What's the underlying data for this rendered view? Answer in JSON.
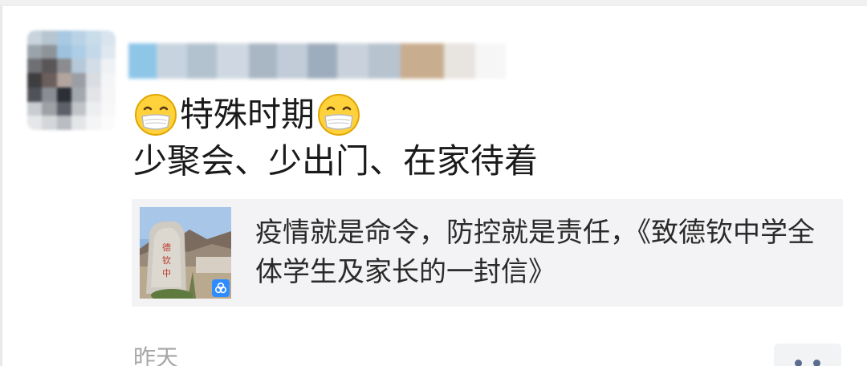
{
  "post": {
    "author_name": "",
    "line1_text": "特殊时期",
    "line1_emoji": "mask-face-emoji",
    "line2_text": "少聚会、少出门、在家待着"
  },
  "link_card": {
    "title": "疫情就是命令，防控就是责任，《致德钦中学全体学生及家长的一封信》",
    "thumbnail": "school-stone-photo",
    "badge_icon": "miniapp-icon"
  },
  "footer": {
    "timestamp": "昨天",
    "more_icon": "more-dots-icon"
  },
  "colors": {
    "text": "#1a1a1a",
    "card_bg": "#f3f3f5",
    "timestamp": "#a6a6a6",
    "action_dots": "#5b6c8f",
    "badge": "#2f8cff"
  }
}
